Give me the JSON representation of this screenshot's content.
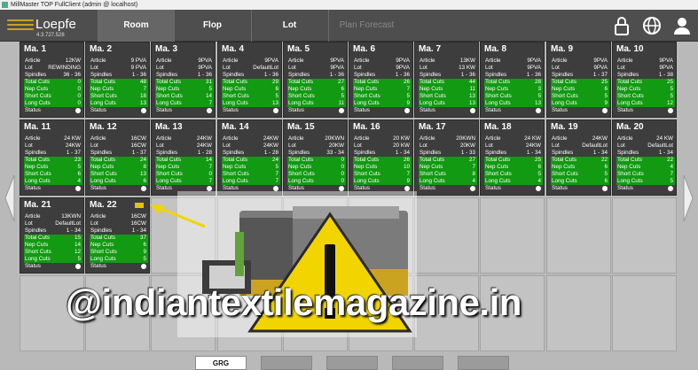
{
  "window_title": "MillMaster TOP FullClient (admin @ localhost)",
  "brand": {
    "name": "Loepfe",
    "version": "4.3.727.528"
  },
  "tabs": [
    {
      "label": "Room",
      "state": "active"
    },
    {
      "label": "Flop",
      "state": "normal"
    },
    {
      "label": "Lot",
      "state": "normal"
    },
    {
      "label": "Plan Forecast",
      "state": "disabled"
    }
  ],
  "header_icons": [
    "lock-icon",
    "globe-icon",
    "user-icon"
  ],
  "field_labels": [
    "Article",
    "Lot",
    "Spindles",
    "Total Cuts",
    "Nep Cuts",
    "Short Cuts",
    "Long Cuts",
    "Status"
  ],
  "machines": [
    {
      "title": "Ma. 1",
      "article": "12KW",
      "lot": "REWINDING",
      "spindles": "36 - 36",
      "total": "0",
      "nep": "0",
      "short": "0",
      "long": "0"
    },
    {
      "title": "Ma. 2",
      "article": "9 PVA",
      "lot": "9 PVA",
      "spindles": "1 - 36",
      "total": "48",
      "nep": "7",
      "short": "18",
      "long": "13"
    },
    {
      "title": "Ma. 3",
      "article": "9PVA",
      "lot": "9PVA",
      "spindles": "1 - 36",
      "total": "31",
      "nep": "5",
      "short": "14",
      "long": "7"
    },
    {
      "title": "Ma. 4",
      "article": "9PVA",
      "lot": "DefaultLot",
      "spindles": "1 - 36",
      "total": "29",
      "nep": "6",
      "short": "5",
      "long": "13"
    },
    {
      "title": "Ma. 5",
      "article": "9PVA",
      "lot": "9PVA",
      "spindles": "1 - 36",
      "total": "27",
      "nep": "6",
      "short": "5",
      "long": "11"
    },
    {
      "title": "Ma. 6",
      "article": "9PVA",
      "lot": "9PVA",
      "spindles": "1 - 36",
      "total": "26",
      "nep": "7",
      "short": "5",
      "long": "9"
    },
    {
      "title": "Ma. 7",
      "article": "13KW",
      "lot": "13 KW",
      "spindles": "1 - 36",
      "total": "44",
      "nep": "11",
      "short": "13",
      "long": "13"
    },
    {
      "title": "Ma. 8",
      "article": "9PVA",
      "lot": "9PVA",
      "spindles": "1 - 36",
      "total": "28",
      "nep": "3",
      "short": "5",
      "long": "13"
    },
    {
      "title": "Ma. 9",
      "article": "9PVA",
      "lot": "9PVA",
      "spindles": "1 - 37",
      "total": "25",
      "nep": "6",
      "short": "5",
      "long": "9"
    },
    {
      "title": "Ma. 10",
      "article": "9PVA",
      "lot": "9PVA",
      "spindles": "1 - 38",
      "total": "25",
      "nep": "5",
      "short": "5",
      "long": "12"
    },
    {
      "title": "Ma. 11",
      "article": "24 KW",
      "lot": "24KW",
      "spindles": "1 - 37",
      "total": "23",
      "nep": "5",
      "short": "6",
      "long": "4"
    },
    {
      "title": "Ma. 12",
      "article": "16CW",
      "lot": "16CW",
      "spindles": "1 - 37",
      "total": "24",
      "nep": "8",
      "short": "13",
      "long": "6"
    },
    {
      "title": "Ma. 13",
      "article": "24KW",
      "lot": "24KW",
      "spindles": "1 - 28",
      "total": "14",
      "nep": "7",
      "short": "0",
      "long": "7"
    },
    {
      "title": "Ma. 14",
      "article": "24KW",
      "lot": "24KW",
      "spindles": "1 - 28",
      "total": "24",
      "nep": "5",
      "short": "7",
      "long": "7"
    },
    {
      "title": "Ma. 15",
      "article": "20KWN",
      "lot": "20KW",
      "spindles": "33 - 34",
      "total": "0",
      "nep": "0",
      "short": "0",
      "long": "0"
    },
    {
      "title": "Ma. 16",
      "article": "20 KW",
      "lot": "20 KW",
      "spindles": "1 - 34",
      "total": "26",
      "nep": "10",
      "short": "7",
      "long": "9"
    },
    {
      "title": "Ma. 17",
      "article": "20KWN",
      "lot": "20KW",
      "spindles": "1 - 33",
      "total": "27",
      "nep": "7",
      "short": "8",
      "long": "4"
    },
    {
      "title": "Ma. 18",
      "article": "24 KW",
      "lot": "24KW",
      "spindles": "1 - 34",
      "total": "25",
      "nep": "6",
      "short": "5",
      "long": "4"
    },
    {
      "title": "Ma. 19",
      "article": "24KW",
      "lot": "DefaultLot",
      "spindles": "1 - 34",
      "total": "22",
      "nep": "6",
      "short": "5",
      "long": "6"
    },
    {
      "title": "Ma. 20",
      "article": "24 KW",
      "lot": "DefaultLot",
      "spindles": "1 - 34",
      "total": "22",
      "nep": "4",
      "short": "7",
      "long": "5"
    },
    {
      "title": "Ma. 21",
      "article": "13KWN",
      "lot": "DefaultLot",
      "spindles": "1 - 34",
      "total": "15",
      "nep": "14",
      "short": "12",
      "long": "5"
    },
    {
      "title": "Ma. 22",
      "article": "16CW",
      "lot": "16CW",
      "spindles": "1 - 34",
      "total": "37",
      "nep": "6",
      "short": "9",
      "long": "5"
    }
  ],
  "bottom_tabs": [
    {
      "label": "GRG",
      "state": "active"
    },
    {
      "label": "",
      "state": "normal"
    },
    {
      "label": "",
      "state": "normal"
    },
    {
      "label": "",
      "state": "normal"
    },
    {
      "label": "",
      "state": "normal"
    }
  ],
  "watermark": "@indiantextilemagazine.in",
  "colors": {
    "header_bg": "#4e4e4e",
    "card_bg": "#3d3d3d",
    "cuts_green": "#129a12",
    "warning_yellow": "#f2d400",
    "arrow_yellow": "#f2d400"
  }
}
